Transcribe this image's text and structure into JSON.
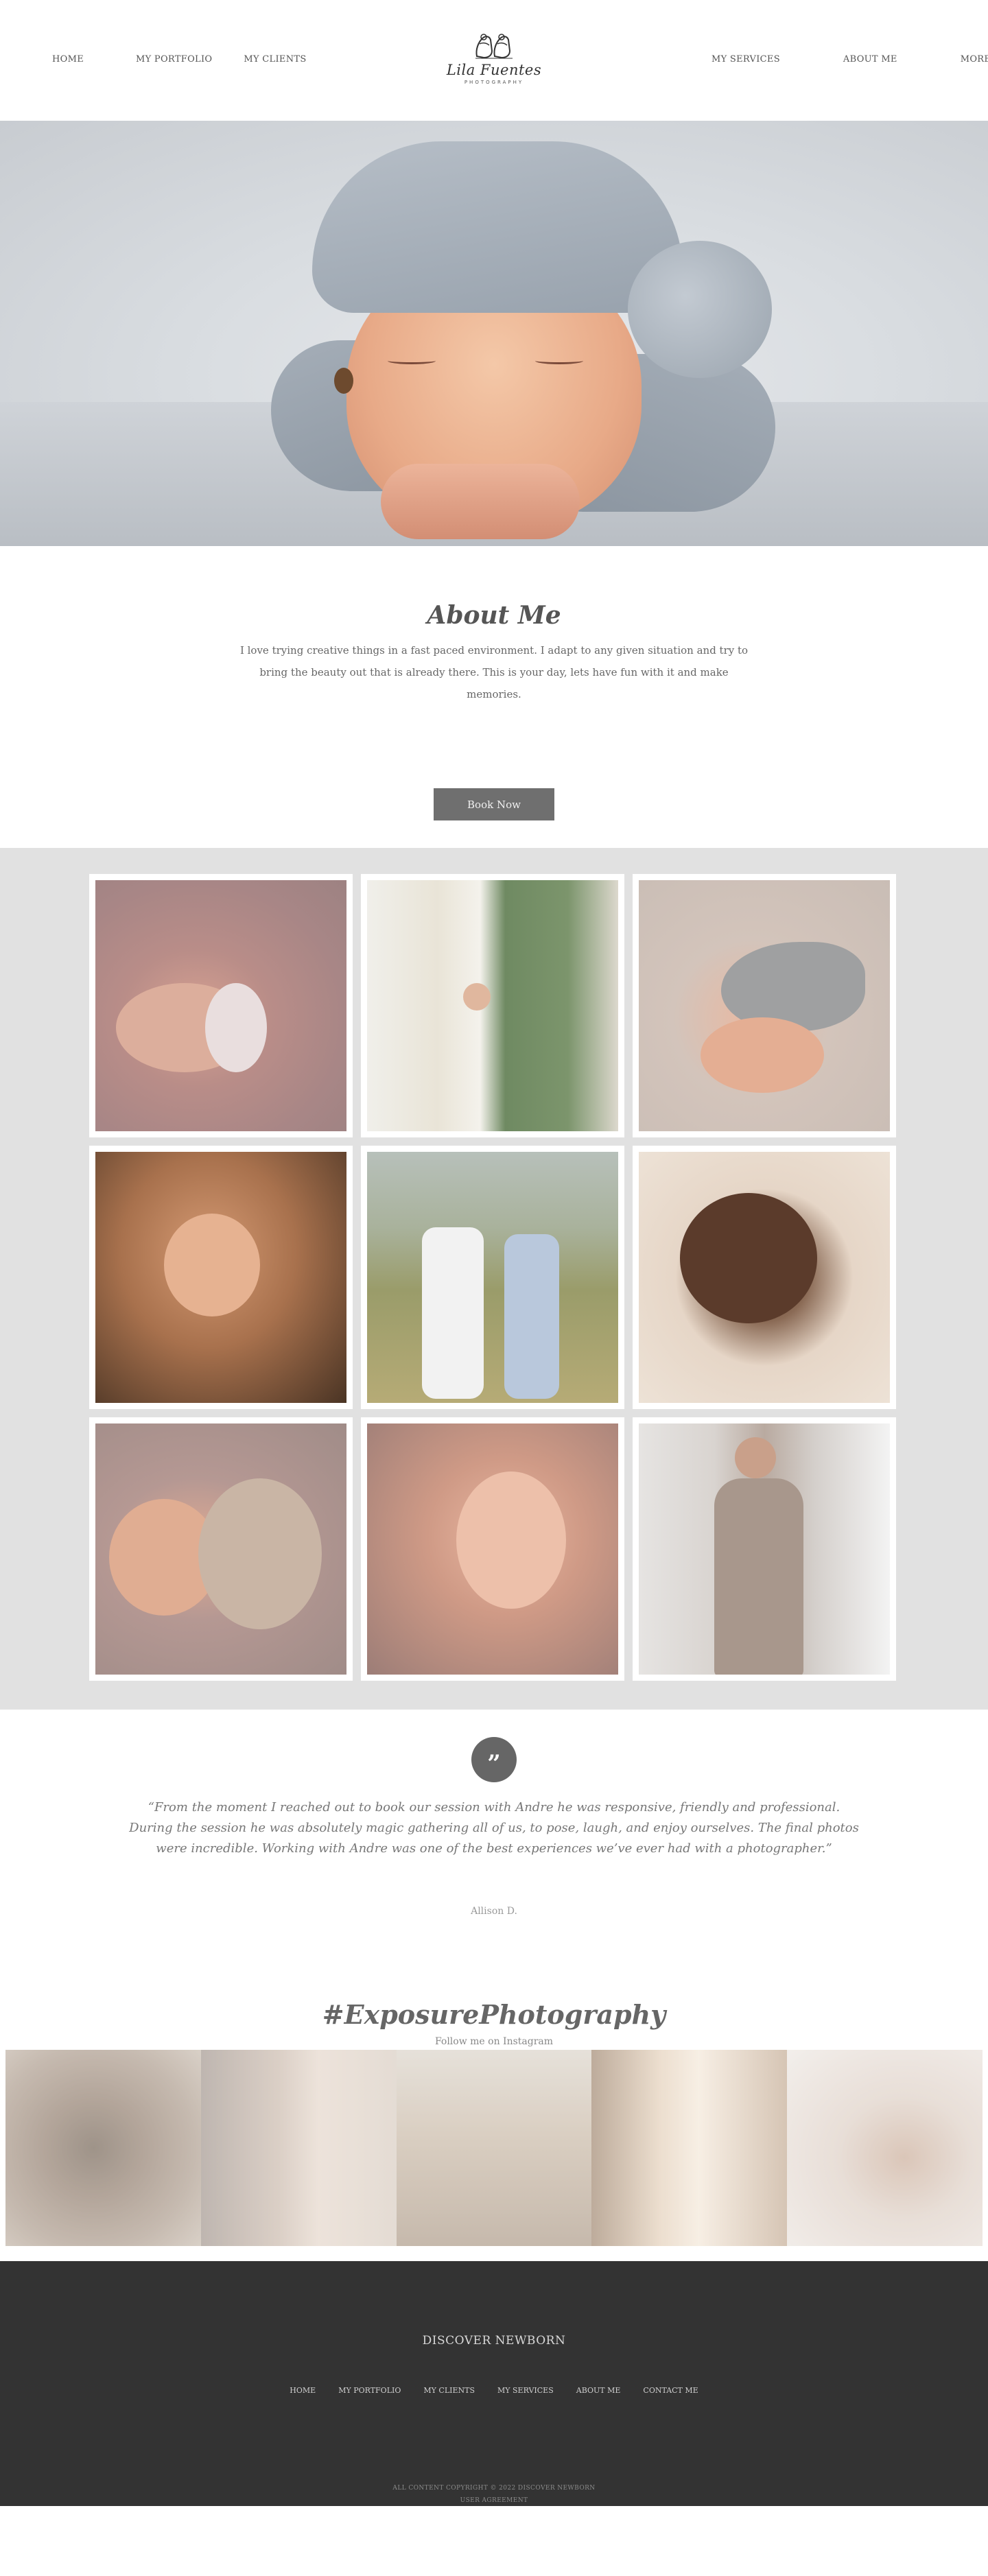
{
  "header": {
    "nav_left": [
      "HOME",
      "MY PORTFOLIO",
      "MY CLIENTS"
    ],
    "nav_right": [
      "MY SERVICES",
      "ABOUT ME",
      "MORE"
    ],
    "logo_name": "Lila Fuentes",
    "logo_sub": "PHOTOGRAPHY",
    "logo_icon": "baby-shoes-icon"
  },
  "hero": {
    "image": "sleeping-newborn-in-knit-hat-photo"
  },
  "about": {
    "title": "About Me",
    "text": "I love trying creative things in a fast paced environment. I adapt to any given situation and try to bring the beauty out that is already there. This is your day, lets have fun with it and make memories.",
    "button_label": "Book Now"
  },
  "gallery": {
    "images": [
      "newborn-with-bunny-toy-photo",
      "expecting-couple-holding-hands-photo",
      "sleeping-newborn-grey-hat-photo",
      "parent-hands-holding-baby-feet-photo",
      "couple-in-field-photo",
      "sleeping-baby-on-blanket-photo",
      "newborn-in-knit-wrap-photo",
      "baby-hand-gripping-finger-photo",
      "pregnant-woman-by-window-photo"
    ]
  },
  "testimonial": {
    "quote_icon": "quote-icon",
    "quote_mark": "”",
    "text": "“From the moment I reached out to book our session with Andre he was responsive, friendly and professional. During the session he was absolutely magic gathering all of us, to pose, laugh, and enjoy ourselves. The final photos were incredible. Working with Andre was one of the best experiences we’ve ever had with a photographer.”",
    "author": "Allison D."
  },
  "instagram": {
    "hashtag": "#ExposurePhotography",
    "subtitle": "Follow me on Instagram",
    "images": [
      "rings-and-flowers-photo",
      "smiling-bearded-man-photo",
      "couple-feet-walking-photo",
      "couple-through-slats-photo",
      "bride-with-flower-crown-photo"
    ]
  },
  "footer": {
    "title": "DISCOVER NEWBORN",
    "nav": [
      "HOME",
      "MY PORTFOLIO",
      "MY CLIENTS",
      "MY SERVICES",
      "ABOUT ME",
      "CONTACT ME"
    ],
    "copyright_line1": "ALL CONTENT COPYRIGHT © 2022 DISCOVER NEWBORN",
    "copyright_line2": "USER AGREEMENT"
  },
  "colors": {
    "button": "#6f6f6f",
    "gallery_bg": "#e1e1e1",
    "footer_bg": "#333333"
  }
}
